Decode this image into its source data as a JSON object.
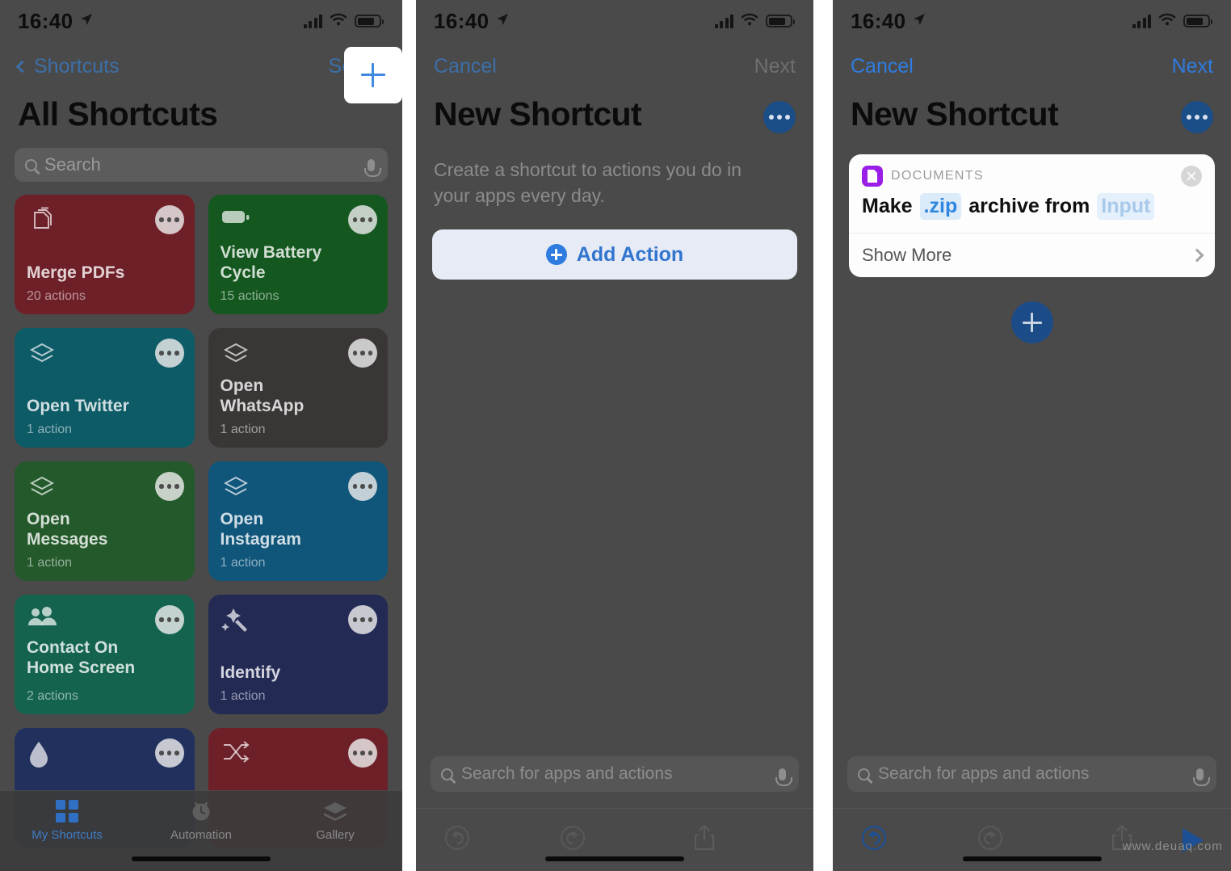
{
  "statusbar": {
    "time": "16:40",
    "location_icon": "location-arrow-icon",
    "cellular_icon": "cellular-bars-icon",
    "wifi_icon": "wifi-icon",
    "battery_icon": "battery-icon"
  },
  "panel1": {
    "nav": {
      "back_label": "Shortcuts",
      "select_label": "Select",
      "add_label": "+",
      "add_icon": "plus-icon",
      "back_icon": "chevron-left-icon"
    },
    "title": "All Shortcuts",
    "search": {
      "placeholder": "Search",
      "search_icon": "search-icon",
      "mic_icon": "microphone-icon"
    },
    "tiles": [
      {
        "name": "Merge PDFs",
        "subtitle": "20 actions",
        "color": "#6e2029",
        "icon": "documents-stack-icon"
      },
      {
        "name": "View Battery Cycle",
        "subtitle": "15 actions",
        "color": "#14571f",
        "icon": "battery-icon"
      },
      {
        "name": "Open Twitter",
        "subtitle": "1 action",
        "color": "#0d5b66",
        "icon": "layers-icon"
      },
      {
        "name": "Open WhatsApp",
        "subtitle": "1 action",
        "color": "#3a3635",
        "icon": "layers-icon"
      },
      {
        "name": "Open Messages",
        "subtitle": "1 action",
        "color": "#24592b",
        "icon": "layers-icon"
      },
      {
        "name": "Open Instagram",
        "subtitle": "1 action",
        "color": "#10557a",
        "icon": "layers-icon"
      },
      {
        "name": "Contact On Home Screen",
        "subtitle": "2 actions",
        "color": "#14634f",
        "icon": "people-icon"
      },
      {
        "name": "Identify",
        "subtitle": "1 action",
        "color": "#232a54",
        "icon": "magic-wand-icon"
      },
      {
        "name": "",
        "subtitle": "",
        "color": "#22305e",
        "icon": "droplet-icon"
      },
      {
        "name": "",
        "subtitle": "",
        "color": "#6e2029",
        "icon": "shuffle-icon"
      }
    ],
    "tabbar": [
      {
        "label": "My Shortcuts",
        "icon": "grid-icon",
        "active": true
      },
      {
        "label": "Automation",
        "icon": "clock-icon",
        "active": false
      },
      {
        "label": "Gallery",
        "icon": "layers-icon",
        "active": false
      }
    ]
  },
  "panel2": {
    "nav": {
      "cancel_label": "Cancel",
      "next_label": "Next"
    },
    "title": "New Shortcut",
    "more_icon": "ellipsis-circle-icon",
    "description": "Create a shortcut to actions you do in your apps every day.",
    "add_action": {
      "label": "Add Action",
      "icon": "plus-circle-icon"
    },
    "search": {
      "placeholder": "Search for apps and actions",
      "search_icon": "search-icon",
      "mic_icon": "microphone-icon"
    },
    "toolbar": [
      {
        "icon": "undo-icon"
      },
      {
        "icon": "redo-icon"
      },
      {
        "icon": "share-icon"
      },
      {
        "icon": "play-icon"
      }
    ]
  },
  "panel3": {
    "nav": {
      "cancel_label": "Cancel",
      "next_label": "Next"
    },
    "title": "New Shortcut",
    "more_icon": "ellipsis-circle-icon",
    "card": {
      "category": "DOCUMENTS",
      "app_icon": "document-icon",
      "close_icon": "close-circle-icon",
      "text_before": "Make",
      "format_token": ".zip",
      "text_middle": "archive from",
      "input_token": "Input",
      "show_more_label": "Show More",
      "chevron_icon": "chevron-right-icon"
    },
    "add_button_icon": "plus-circle-icon",
    "search": {
      "placeholder": "Search for apps and actions",
      "search_icon": "search-icon",
      "mic_icon": "microphone-icon"
    },
    "toolbar": [
      {
        "icon": "undo-icon"
      },
      {
        "icon": "redo-icon"
      },
      {
        "icon": "share-icon"
      },
      {
        "icon": "play-icon"
      }
    ]
  },
  "watermark": "www.deuaq.com",
  "colors": {
    "ios_blue": "#2f7ce0",
    "dim_background": "#4a4a4a",
    "card_white": "#fdfdfd",
    "purple_app": "#9b1ee8",
    "chip_blue": "#2f86de"
  }
}
